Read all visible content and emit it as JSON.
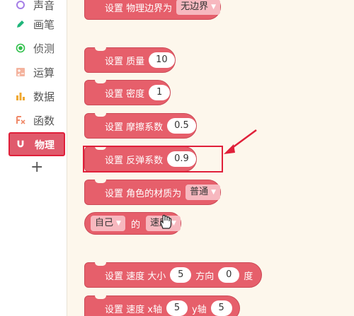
{
  "sidebar": {
    "items": [
      {
        "label": "声音",
        "icon": "sound-icon",
        "color": "#a57ee6"
      },
      {
        "label": "画笔",
        "icon": "pen-icon",
        "color": "#1fb57a"
      },
      {
        "label": "侦测",
        "icon": "sensing-icon",
        "color": "#2fbf4a"
      },
      {
        "label": "运算",
        "icon": "operator-icon",
        "color": "#f08a6a"
      },
      {
        "label": "数据",
        "icon": "data-icon",
        "color": "#f0a830"
      },
      {
        "label": "函数",
        "icon": "function-icon",
        "color": "#f08a6a"
      },
      {
        "label": "物理",
        "icon": "magnet-icon",
        "color": "#e05a6c",
        "active": true
      }
    ],
    "add_label": "+"
  },
  "blocks": {
    "boundary": {
      "text": "设置 物理边界为",
      "value": "无边界"
    },
    "mass": {
      "text": "设置 质量",
      "value": "10"
    },
    "density": {
      "text": "设置 密度",
      "value": "1"
    },
    "friction": {
      "text": "设置 摩擦系数",
      "value": "0.5"
    },
    "bounce": {
      "text": "设置 反弹系数",
      "value": "0.9"
    },
    "material": {
      "text": "设置 角色的材质为",
      "value": "普通"
    },
    "reporter": {
      "target": "自己",
      "of": "的",
      "property": "速度"
    },
    "speed_dir": {
      "text": "设置 速度 大小",
      "size": "5",
      "dir_label": "方向",
      "dir": "0",
      "unit": "度"
    },
    "speed_xy": {
      "text": "设置 速度 x轴",
      "x": "5",
      "y_label": "y轴",
      "y": "5"
    }
  },
  "colors": {
    "block": "#e65f6b",
    "highlight": "#e0203a",
    "background": "#fdf7ec"
  }
}
